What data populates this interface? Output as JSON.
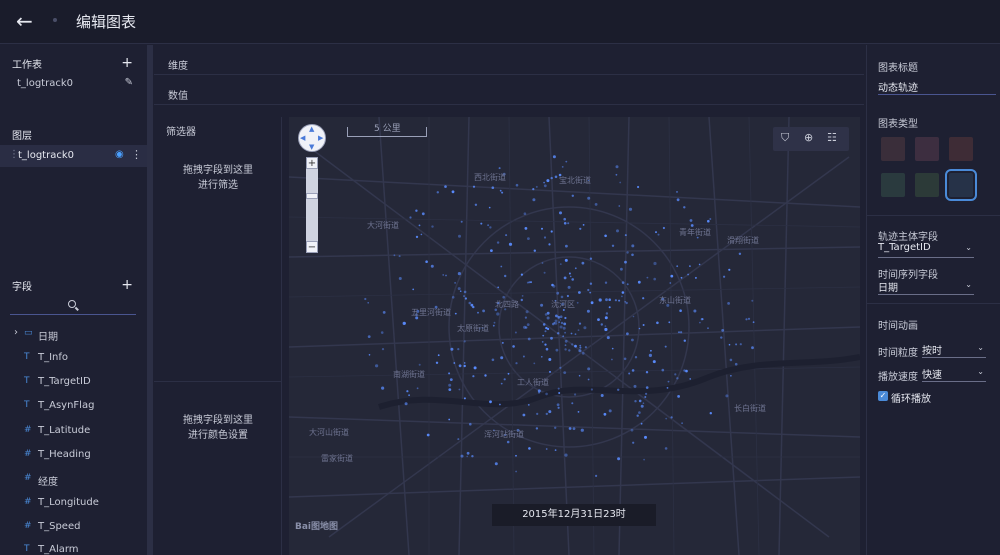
{
  "header": {
    "back_icon": "arrow-left-icon",
    "title": "编辑图表"
  },
  "worksheet": {
    "title": "工作表",
    "item": "t_logtrack0"
  },
  "layers": {
    "title": "图层",
    "item": "t_logtrack0"
  },
  "fields": {
    "title": "字段",
    "items": [
      {
        "type": "date",
        "label": "日期"
      },
      {
        "type": "T",
        "label": "T_Info"
      },
      {
        "type": "T",
        "label": "T_TargetID"
      },
      {
        "type": "T",
        "label": "T_AsynFlag"
      },
      {
        "type": "#",
        "label": "T_Latitude"
      },
      {
        "type": "#",
        "label": "T_Heading"
      },
      {
        "type": "#",
        "label": "经度"
      },
      {
        "type": "#",
        "label": "T_Longitude"
      },
      {
        "type": "#",
        "label": "T_Speed"
      },
      {
        "type": "T",
        "label": "T_Alarm"
      }
    ]
  },
  "shelves": {
    "dimension": "维度",
    "value": "数值"
  },
  "filter": {
    "title": "筛选器",
    "drop_filter": "拖拽字段到这里\n进行筛选",
    "drop_color": "拖拽字段到这里\n进行颜色设置"
  },
  "map": {
    "scale": "5 公里",
    "time": "2015年12月31日23时",
    "logo": "Bai图地图",
    "labels": [
      "西北街道",
      "宝北街道",
      "大河街道",
      "青年街道",
      "滑翔街道",
      "东山街道",
      "北四路",
      "五里河街道",
      "沈河区",
      "南湖街道",
      "工人街道",
      "太原街道",
      "大河山街道",
      "浑河站街道",
      "长白街道",
      "雷家街道"
    ]
  },
  "chart": {
    "title_label": "图表标题",
    "title_value": "动态轨迹",
    "type_label": "图表类型",
    "types": [
      "heat-map-type",
      "region-map-type",
      "flow-map-type",
      "scatter-map-type",
      "path-map-type",
      "track-map-type"
    ],
    "subject_label": "轨迹主体字段",
    "subject_value": "T_TargetID",
    "time_field_label": "时间序列字段",
    "time_field_value": "日期",
    "animation_label": "时间动画",
    "granularity_label": "时间粒度",
    "granularity_value": "按时",
    "speed_label": "播放速度",
    "speed_value": "快速",
    "loop_label": "循环播放",
    "loop_checked": true
  }
}
